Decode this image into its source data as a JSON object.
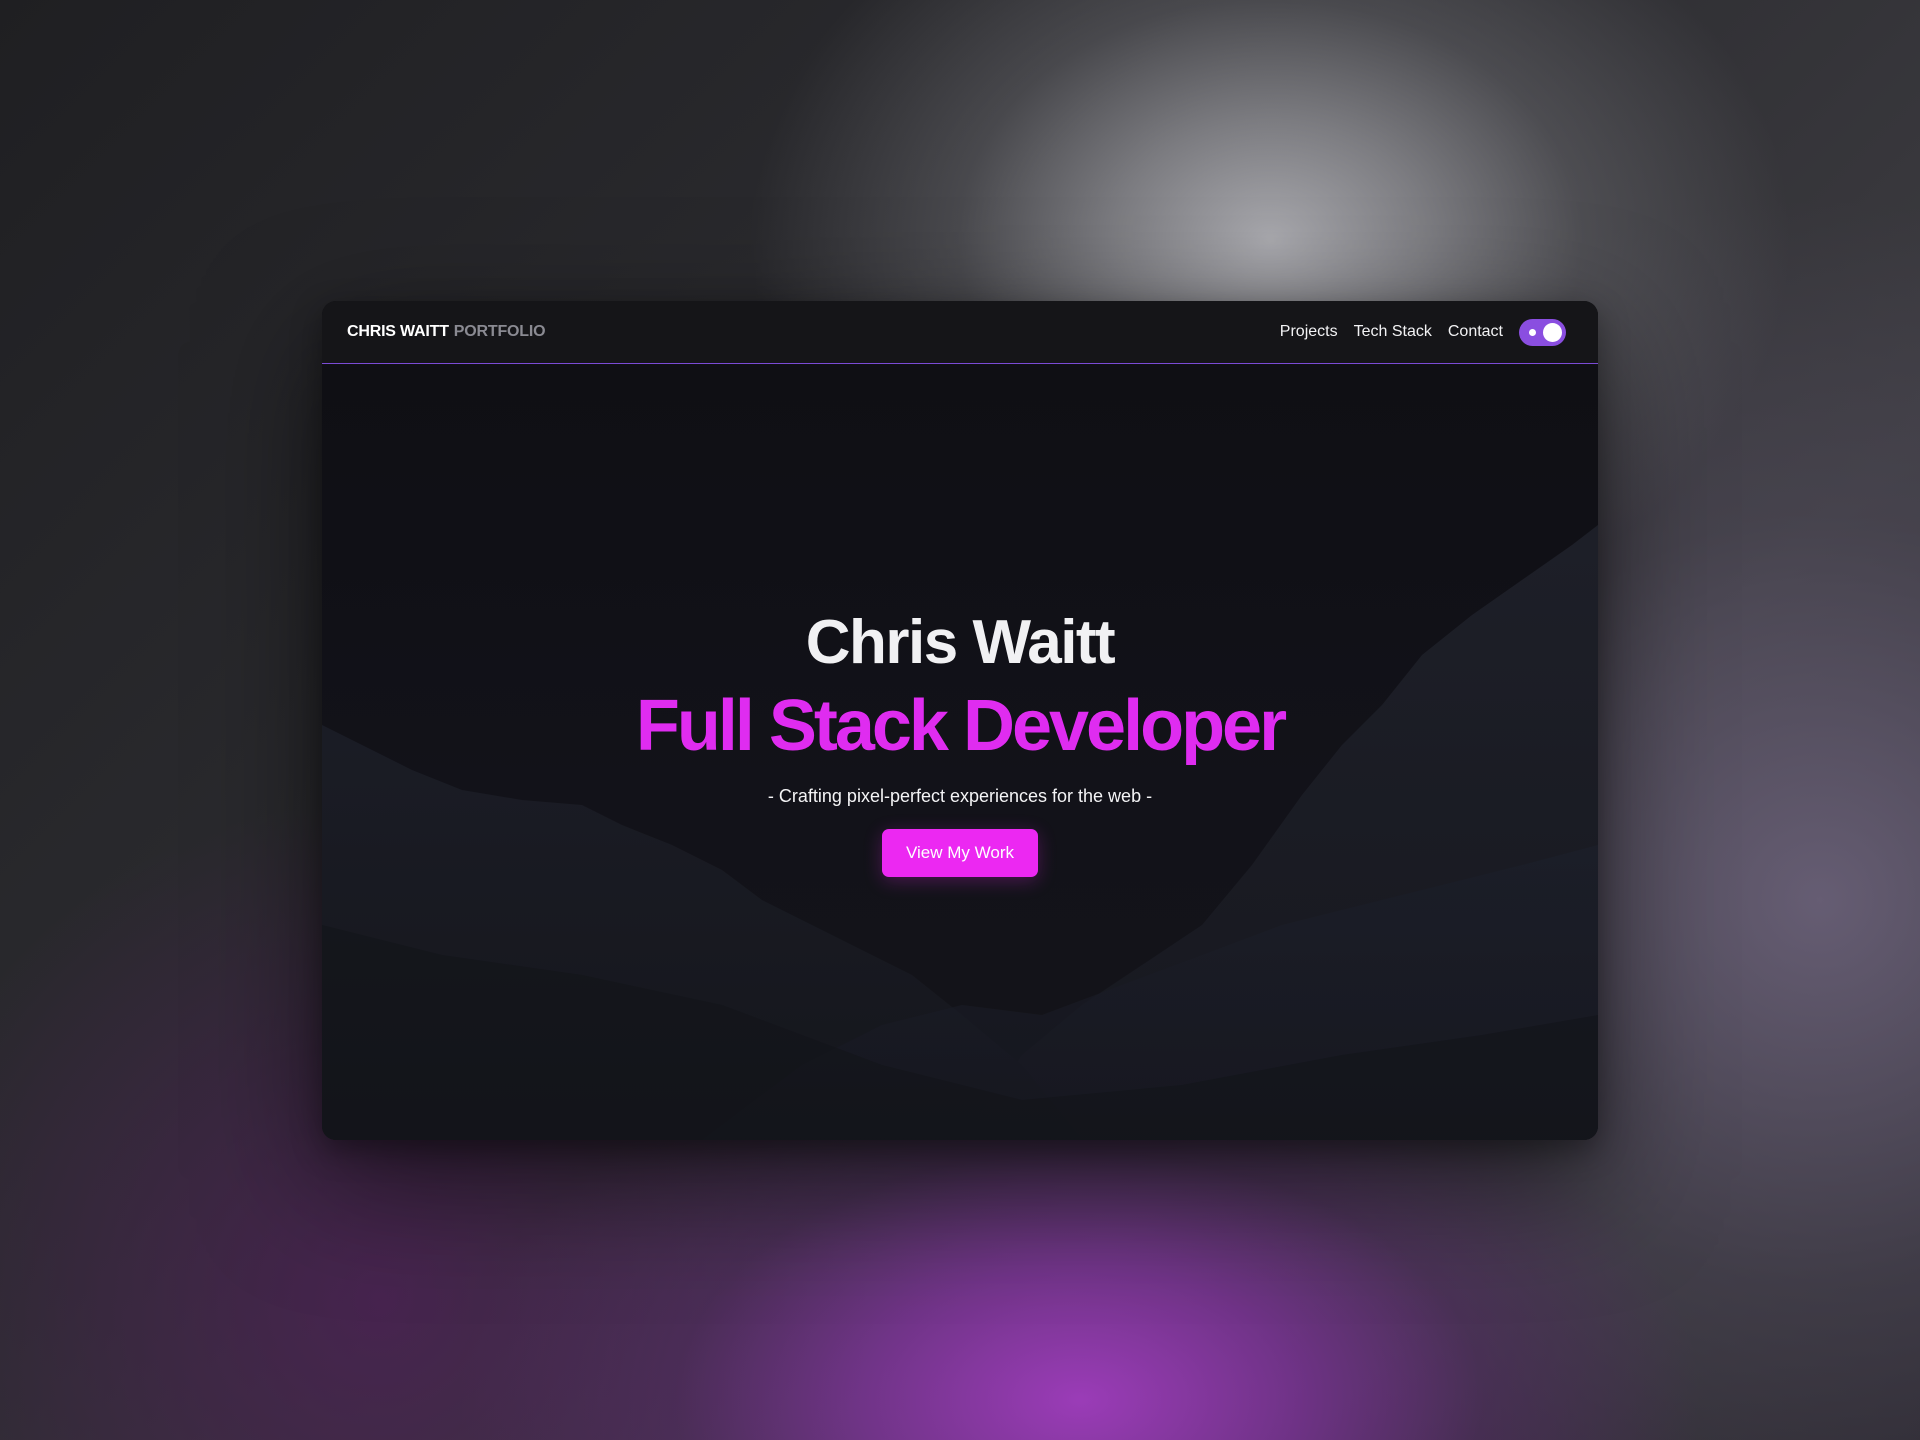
{
  "header": {
    "brand_name": "CHRIS WAITT",
    "brand_suffix": "PORTFOLIO",
    "nav": [
      {
        "label": "Projects"
      },
      {
        "label": "Tech Stack"
      },
      {
        "label": "Contact"
      }
    ],
    "theme_toggle": {
      "state": "on"
    }
  },
  "hero": {
    "name": "Chris Waitt",
    "role": "Full Stack Developer",
    "tagline": "- Crafting pixel-perfect experiences for the web -",
    "cta_label": "View My Work"
  },
  "colors": {
    "accent": "#ec28f2",
    "toggle": "#8a4ee0",
    "nav_border": "#7b4bd6",
    "window_bg": "#101014"
  }
}
